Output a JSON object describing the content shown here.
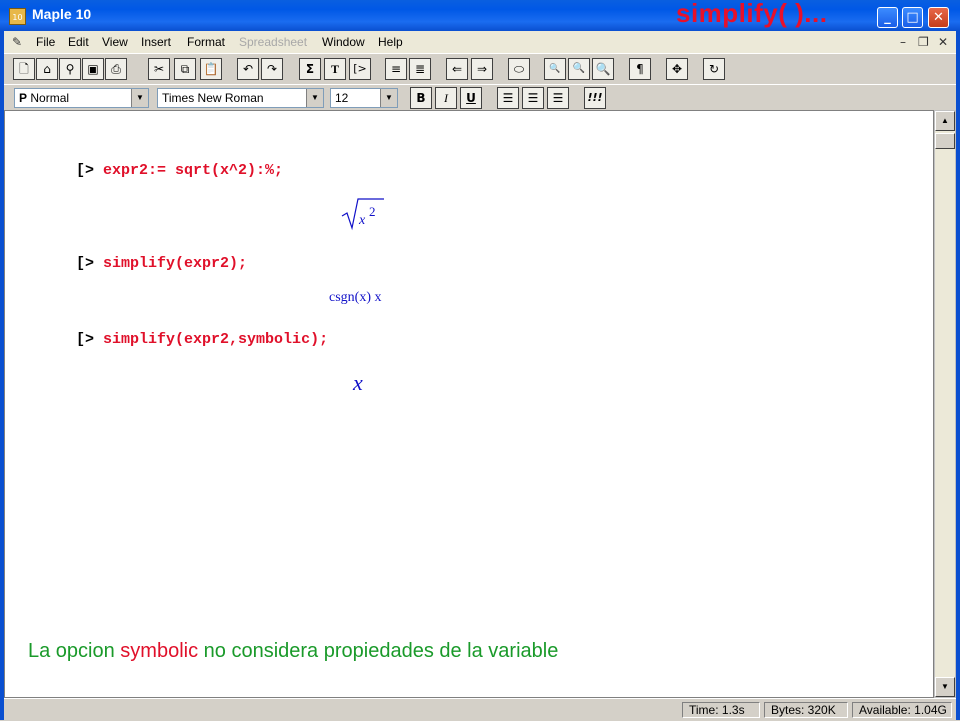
{
  "window": {
    "title": "Maple 10",
    "overlay_title": "simplify( )...",
    "icon_text": "10"
  },
  "menu": {
    "items": [
      "File",
      "Edit",
      "View",
      "Insert",
      "Format",
      "Spreadsheet",
      "Window",
      "Help"
    ],
    "disabled": [
      "Spreadsheet"
    ]
  },
  "toolbar1": {
    "icons": [
      "new-document-icon",
      "open-icon",
      "open-url-icon",
      "save-icon",
      "print-icon",
      "cut-icon",
      "copy-icon",
      "paste-icon",
      "undo-icon",
      "redo-icon",
      "sigma-icon",
      "text-icon",
      "prompt-icon",
      "insert-before-icon",
      "insert-after-icon",
      "back-icon",
      "forward-icon",
      "stop-icon",
      "zoom-small-icon",
      "zoom-medium-icon",
      "zoom-large-icon",
      "pilcrow-icon",
      "expand-icon",
      "restart-icon"
    ]
  },
  "toolbar2": {
    "style_value": "Normal",
    "style_prefix": "P",
    "font_value": "Times New Roman",
    "size_value": "12",
    "bold_label": "B",
    "italic_label": "I",
    "underline_label": "U",
    "execute_label": "!!!"
  },
  "document": {
    "prompt_symbol": "[>",
    "commands": [
      {
        "input": "expr2:= sqrt(x^2):%;",
        "output_kind": "sqrt",
        "output_base": "x",
        "output_exp": "2"
      },
      {
        "input": "simplify(expr2);",
        "output_kind": "text",
        "output": "csgn(x) x"
      },
      {
        "input": "simplify(expr2,symbolic);",
        "output_kind": "text",
        "output": "x"
      }
    ]
  },
  "caption": {
    "before": "La opcion ",
    "highlight": "symbolic",
    "after": " no considera propiedades de la variable"
  },
  "status": {
    "time": "Time:  1.3s",
    "bytes": "Bytes:  320K",
    "available": "Available:  1.04G"
  },
  "colors": {
    "input": "#e0102a",
    "output": "#1010c8",
    "caption": "#1a9a2a",
    "overlay": "#e8102a"
  }
}
